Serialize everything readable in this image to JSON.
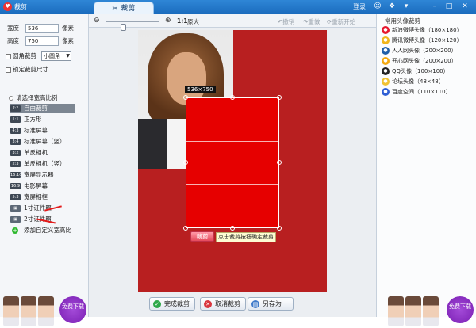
{
  "window": {
    "app_title": "裁剪",
    "tab_label": "裁剪",
    "login": "登录",
    "icon_colors": {
      "accent": "#1a6bbd",
      "canvas": "#b81f20",
      "crop": "#e60000"
    }
  },
  "left": {
    "width_label": "宽度",
    "width_value": "536",
    "width_unit": "像素",
    "height_label": "高度",
    "height_value": "750",
    "height_unit": "像素",
    "rounded_label": "圆角裁剪",
    "rounded_select": "小圆角",
    "lock_label": "锁定裁剪尺寸",
    "ratio_header": "请选择宽高比例",
    "ratios": [
      {
        "badge": "?:?",
        "label": "自由裁剪"
      },
      {
        "badge": "1:1",
        "label": "正方形"
      },
      {
        "badge": "4:3",
        "label": "标准屏幕"
      },
      {
        "badge": "3:4",
        "label": "标准屏幕（竖）"
      },
      {
        "badge": "3:2",
        "label": "单反相机"
      },
      {
        "badge": "2:3",
        "label": "单反相机（竖）"
      },
      {
        "badge": "16:10",
        "label": "宽屏显示器"
      },
      {
        "badge": "16:9",
        "label": "电影屏幕"
      },
      {
        "badge": "5:3",
        "label": "宽屏相框"
      },
      {
        "badge": "",
        "label": "1寸证件照"
      },
      {
        "badge": "",
        "label": "2寸证件照"
      },
      {
        "badge": "+",
        "label": "添加自定义宽高比"
      }
    ],
    "promo_btn": "免费下载"
  },
  "toolbar": {
    "scale": "1:1",
    "zoom_in": "原大",
    "undo": "撤销",
    "redo": "重做",
    "restart": "重新开始"
  },
  "canvas": {
    "dimension": "536×750",
    "crop_button": "裁剪",
    "crop_hint": "点击裁剪按钮确定裁剪"
  },
  "bottom": {
    "finish": "完成裁剪",
    "cancel": "取消裁剪",
    "save_as": "另存为"
  },
  "right": {
    "title": "常用头像裁剪",
    "items": [
      "新浪微博头像（180×180）",
      "腾讯微博头像（120×120）",
      "人人网头像（200×200）",
      "开心网头像（200×200）",
      "QQ头像（100×100）",
      "论坛头像（48×48）",
      "百度空间（110×110）"
    ],
    "promo_btn": "免费下载"
  }
}
